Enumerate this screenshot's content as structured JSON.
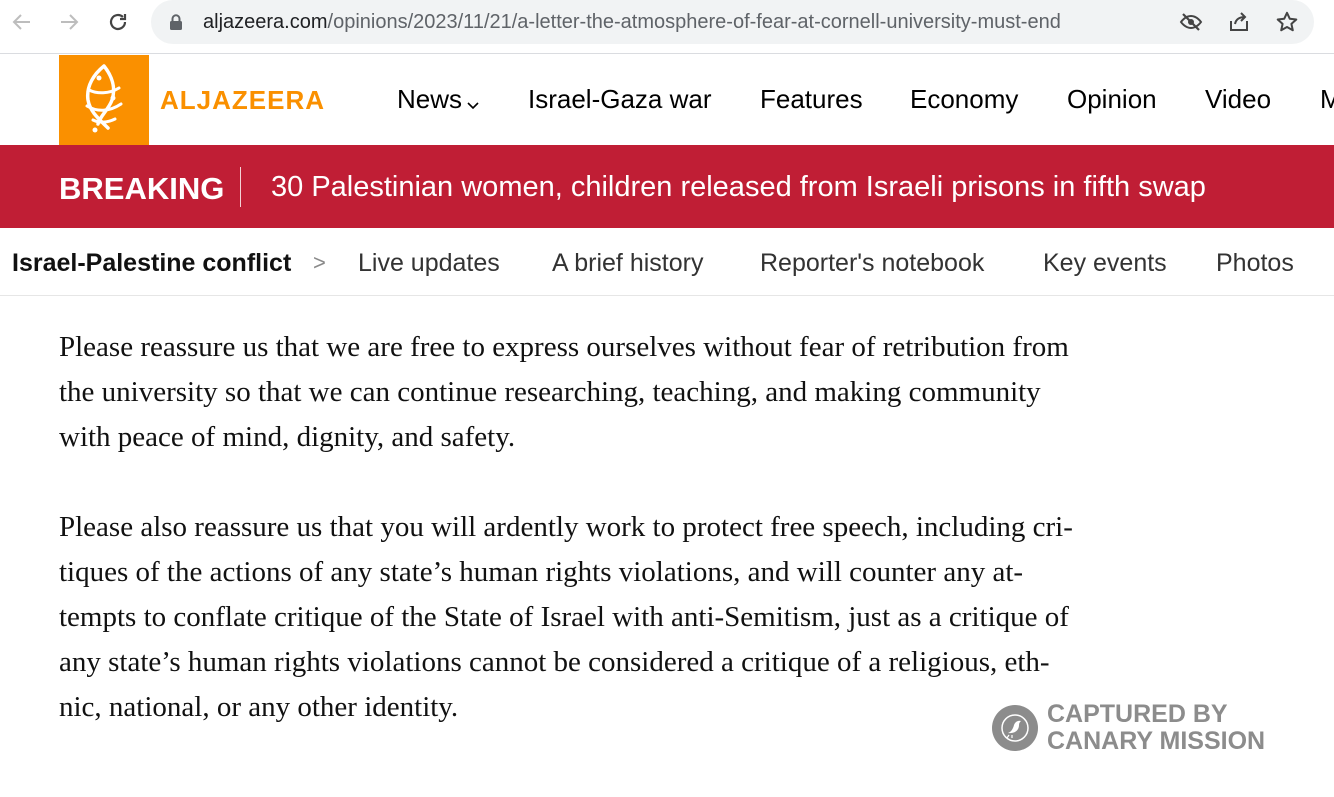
{
  "browser": {
    "url_host": "aljazeera.com",
    "url_path": "/opinions/2023/11/21/a-letter-the-atmosphere-of-fear-at-cornell-university-must-end",
    "icons": [
      "back-icon",
      "forward-icon",
      "reload-icon",
      "lock-icon",
      "eye-off-icon",
      "share-icon",
      "star-icon"
    ]
  },
  "header": {
    "logo_text": "ALJAZEERA",
    "nav": [
      "News",
      "Israel-Gaza war",
      "Features",
      "Economy",
      "Opinion",
      "Video",
      "M"
    ]
  },
  "breaking": {
    "label": "BREAKING",
    "headline": "30 Palestinian women, children released from Israeli prisons in fifth swap"
  },
  "topic": {
    "title": "Israel-Palestine conflict",
    "arrow": ">",
    "links": [
      "Live updates",
      "A brief history",
      "Reporter's notebook",
      "Key events",
      "Photos"
    ]
  },
  "article": {
    "paragraphs": [
      [
        "Please reassure us that we are free to express ourselves without fear of retribution from",
        "the university so that we can continue researching, teaching, and making community",
        "with peace of mind, dignity, and safety."
      ],
      [
        "Please also reassure us that you will ardently work to protect free speech, including cri-",
        "tiques of the actions of any state’s human rights violations, and will counter any at-",
        "tempts to conflate critique of the State of Israel with anti-Semitism, just as a critique of",
        "any state’s human rights violations cannot be considered a critique of a religious, eth-",
        "nic, national, or any other identity."
      ]
    ]
  },
  "watermark": {
    "line1": "CAPTURED BY",
    "line2": "CANARY MISSION"
  },
  "colors": {
    "brand_orange": "#fa9000",
    "breaking_red": "#c01e35"
  }
}
